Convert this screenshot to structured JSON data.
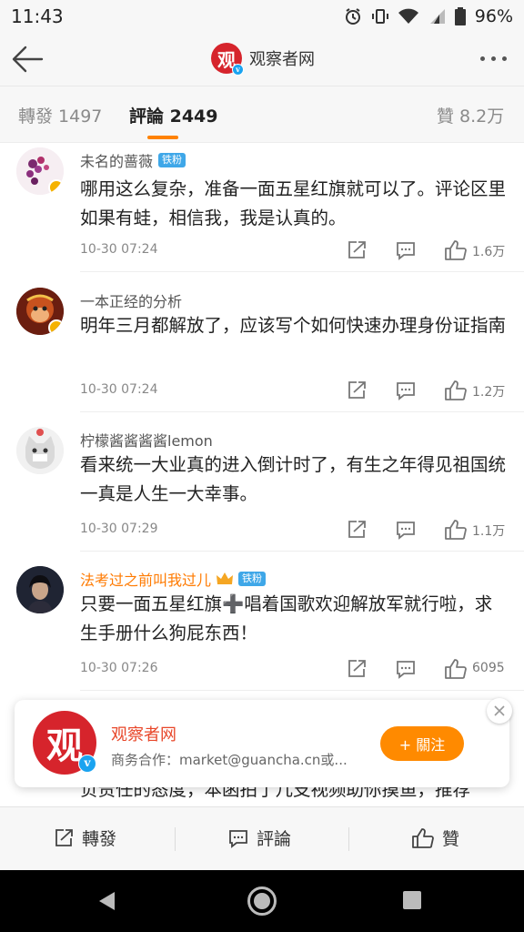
{
  "status_bar": {
    "time": "11:43",
    "battery": "96%"
  },
  "header": {
    "logo_char": "观",
    "title": "观察者网",
    "back_icon": "arrow-left-icon",
    "more_icon": "more-dots-icon"
  },
  "tabs": {
    "repost": "轉發 1497",
    "comments": "評論 2449",
    "likes": "贊 8.2万",
    "accent": "#ff8200"
  },
  "comments": [
    {
      "name": "未名的蔷薇",
      "badge": "铁粉",
      "text": "哪用这么复杂，准备一面五星红旗就可以了。评论区里如果有蛙，相信我，我是认真的。",
      "time": "10-30 07:24",
      "likes": "1.6万"
    },
    {
      "name": "一本正经的分析",
      "badge": "",
      "text": "明年三月都解放了，应该写个如何快速办理身份证指南",
      "time": "10-30 07:24",
      "likes": "1.2万"
    },
    {
      "name": "柠檬酱酱酱酱lemon",
      "badge": "",
      "text": "看来统一大业真的进入倒计时了，有生之年得见祖国统一真是人生一大幸事。",
      "time": "10-30 07:29",
      "likes": "1.1万"
    },
    {
      "name": "法考过之前叫我过儿",
      "badge": "铁粉",
      "text": "只要一面五星红旗➕唱着国歌欢迎解放军就行啦，求生手册什么狗屁东西！",
      "time": "10-30 07:26",
      "likes": "6095"
    }
  ],
  "partial_comment": "负责任的态度，本函拍了几支视频助你摸鱼，推荐",
  "popup": {
    "logo_char": "观",
    "name": "观察者网",
    "desc": "商务合作：market@guancha.cn或...",
    "follow": "+ 關注"
  },
  "bottom_bar": {
    "repost": "轉發",
    "comment": "評論",
    "like": "贊"
  }
}
